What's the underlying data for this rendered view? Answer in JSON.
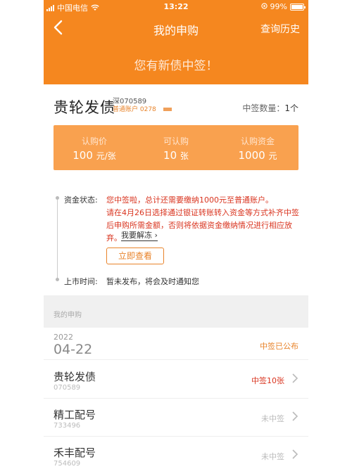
{
  "status_bar": {
    "carrier": "中国电信",
    "time": "13:22",
    "battery": "99%",
    "battery_level": 0.99
  },
  "nav": {
    "title": "我的申购",
    "history": "查询历史",
    "back_icon": "chevron-left-icon"
  },
  "hero": {
    "message": "您有新债中签！"
  },
  "bond": {
    "name": "贵轮发债",
    "market_code": "深070589",
    "account": "普通账户 0278",
    "quantity_label": "中签数量：",
    "quantity_value": "1个"
  },
  "summary": [
    {
      "label": "认购价",
      "value": "100",
      "unit": "元/张"
    },
    {
      "label": "可认购",
      "value": "10",
      "unit": "张"
    },
    {
      "label": "认购资金",
      "value": "1000",
      "unit": "元"
    }
  ],
  "detail": {
    "fund_label": "资金状态:",
    "fund_line1": "您中签啦，总计还需要缴纳1000元至普通账户。",
    "fund_line2": "请在4月26日选择通过银证转账转入资金等方式补齐中签后申购所需金额，否则将依据资金缴纳情况进行相应放弃。",
    "unfreeze_link": "我要解冻 ›",
    "check_button": "立即查看",
    "list_label": "上市时间:",
    "list_text": "暂未发布，将会及时通知您"
  },
  "section": {
    "label": "我的申购"
  },
  "date_group": {
    "year": "2022",
    "day": "04-22",
    "status": "中签已公布"
  },
  "rows": [
    {
      "name": "贵轮发债",
      "code": "070589",
      "status": "中签10张",
      "win": true
    },
    {
      "name": "精工配号",
      "code": "733496",
      "status": "未中签",
      "win": false
    },
    {
      "name": "禾丰配号",
      "code": "754609",
      "status": "未中签",
      "win": false
    }
  ],
  "colors": {
    "primary": "#f5871f",
    "box": "#f9a14f",
    "alert": "#d9341f"
  }
}
